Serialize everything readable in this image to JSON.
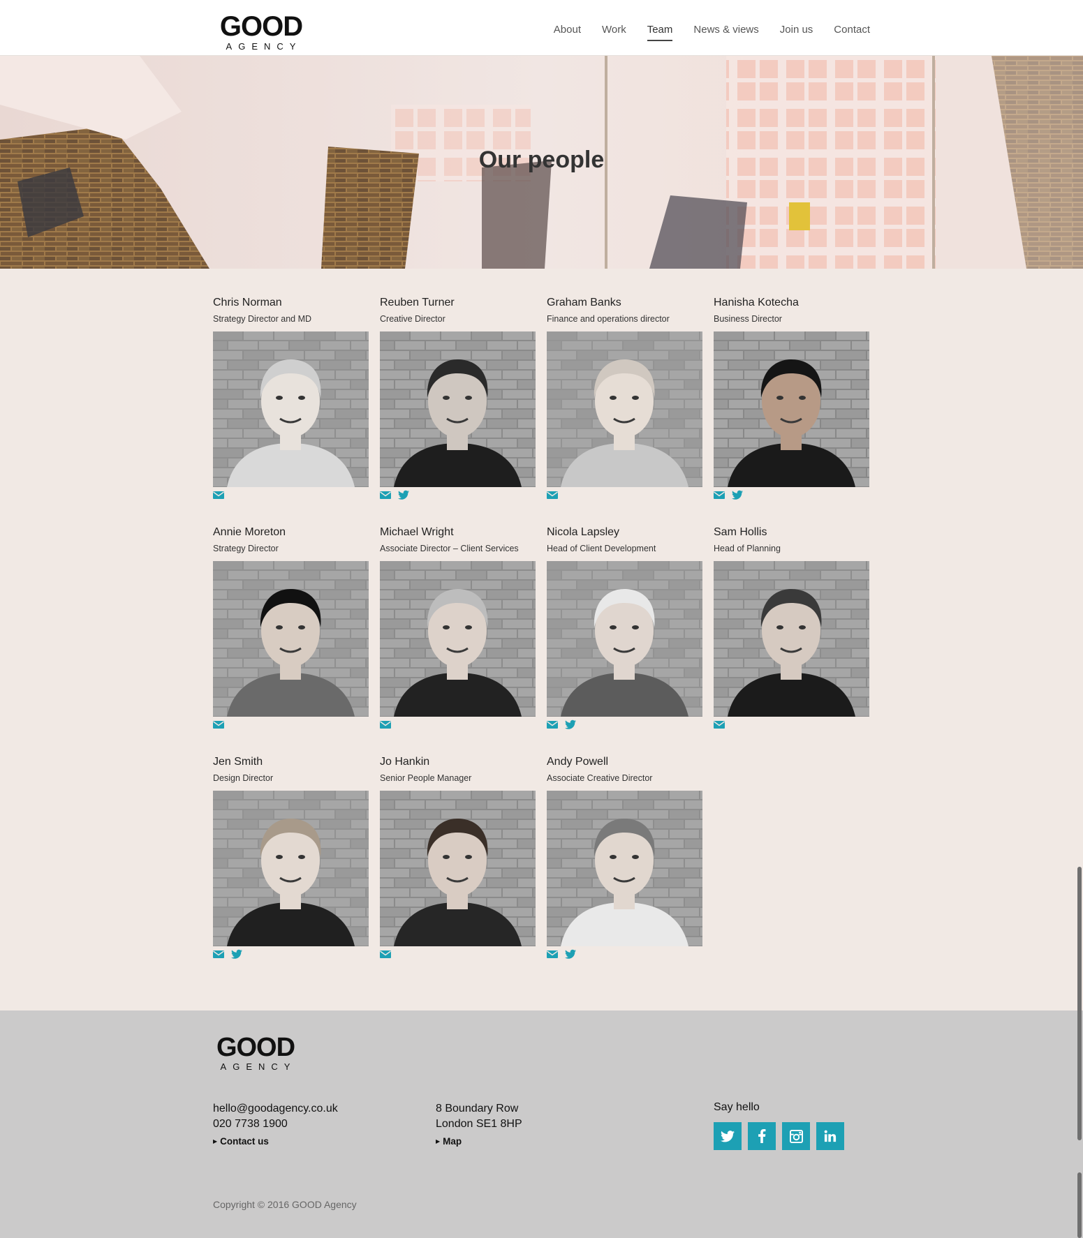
{
  "header": {
    "logo_word": "GOOD",
    "logo_sub": "AGENCY",
    "nav": [
      {
        "label": "About",
        "active": false
      },
      {
        "label": "Work",
        "active": false
      },
      {
        "label": "Team",
        "active": true
      },
      {
        "label": "News & views",
        "active": false
      },
      {
        "label": "Join us",
        "active": false
      },
      {
        "label": "Contact",
        "active": false
      }
    ]
  },
  "hero": {
    "title": "Our people"
  },
  "team": [
    {
      "name": "Chris Norman",
      "role": "Strategy Director and MD",
      "links": [
        "email"
      ]
    },
    {
      "name": "Reuben Turner",
      "role": "Creative Director",
      "links": [
        "email",
        "twitter"
      ]
    },
    {
      "name": "Graham Banks",
      "role": "Finance and operations director",
      "links": [
        "email"
      ]
    },
    {
      "name": "Hanisha Kotecha",
      "role": "Business Director",
      "links": [
        "email",
        "twitter"
      ]
    },
    {
      "name": "Annie Moreton",
      "role": "Strategy Director",
      "links": [
        "email"
      ]
    },
    {
      "name": "Michael Wright",
      "role": "Associate Director – Client Services",
      "links": [
        "email"
      ]
    },
    {
      "name": "Nicola Lapsley",
      "role": "Head of Client Development",
      "links": [
        "email",
        "twitter"
      ]
    },
    {
      "name": "Sam Hollis",
      "role": "Head of Planning",
      "links": [
        "email"
      ]
    },
    {
      "name": "Jen Smith",
      "role": "Design Director",
      "links": [
        "email",
        "twitter"
      ]
    },
    {
      "name": "Jo Hankin",
      "role": "Senior People Manager",
      "links": [
        "email"
      ]
    },
    {
      "name": "Andy Powell",
      "role": "Associate Creative Director",
      "links": [
        "email",
        "twitter"
      ]
    }
  ],
  "footer": {
    "logo_word": "GOOD",
    "logo_sub": "AGENCY",
    "email": "hello@goodagency.co.uk",
    "phone": "020 7738 1900",
    "contact_link": "Contact us",
    "address_line1": "8 Boundary Row",
    "address_line2": "London SE1 8HP",
    "map_link": "Map",
    "say_hello": "Say hello",
    "socials": [
      "twitter",
      "facebook",
      "instagram",
      "linkedin"
    ],
    "copyright": "Copyright © 2016 GOOD Agency"
  },
  "colors": {
    "accent": "#1da0b4",
    "page_bg": "#f1e9e4",
    "footer_bg": "#cbcaca"
  }
}
